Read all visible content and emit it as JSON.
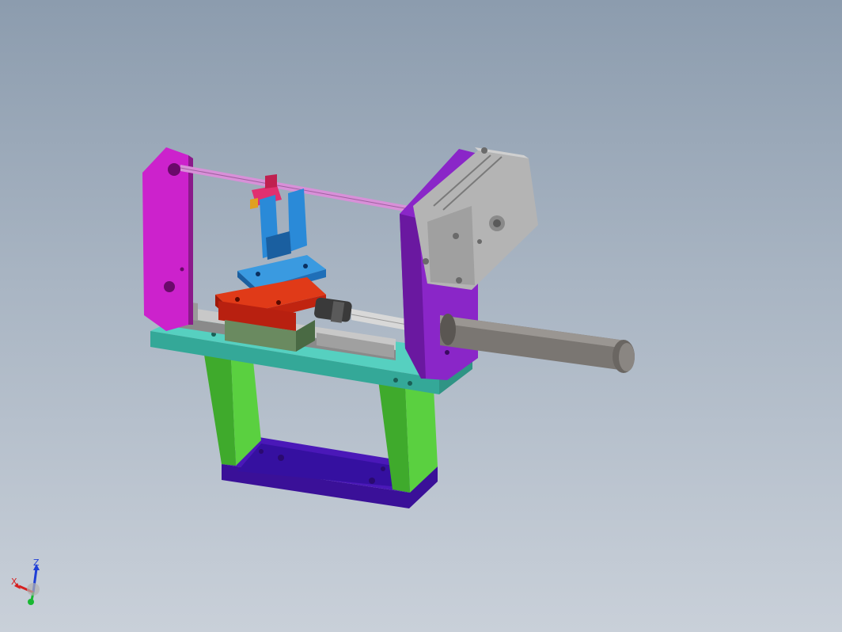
{
  "viewport": {
    "background_top": "#8c9cae",
    "background_bottom": "#c9d0d9"
  },
  "triad": {
    "z_label": "Z",
    "x_label": "X",
    "z_color": "#1f3fd6",
    "x_color": "#d62020",
    "y_color": "#18b832"
  },
  "parts": {
    "base_plate_color": "#5a18c8",
    "legs_color": "#3dbb2a",
    "top_plate_color": "#3bbcb0",
    "left_bracket_color": "#cc22cc",
    "right_bracket_color": "#8a22c0",
    "rail_color": "#b8b8b8",
    "slider_red_color": "#cc2a10",
    "slider_green_color": "#6a8a60",
    "blue_block_color": "#1f7fcc",
    "cylinder_body_color": "#c0c0c0",
    "rod_color": "#808080",
    "guide_rod_color": "#d68ad6",
    "switch_color": "#e03070"
  }
}
